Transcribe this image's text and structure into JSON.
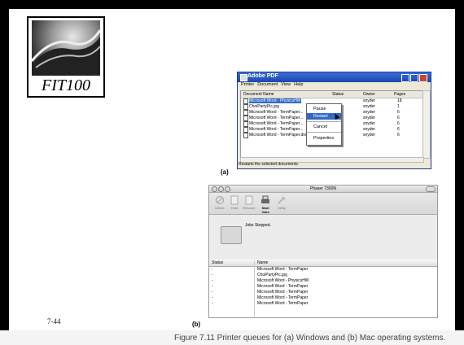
{
  "slide": {
    "logo_text": "FIT100",
    "page_number": "7-44",
    "caption": "Figure 7.11  Printer queues for (a) Windows and (b) Mac operating systems.",
    "label_a": "(a)",
    "label_b": "(b)"
  },
  "windows": {
    "title": "Adobe PDF",
    "menu": [
      "Printer",
      "Document",
      "View",
      "Help"
    ],
    "columns": [
      "Document Name",
      "Status",
      "Owner",
      "Pages"
    ],
    "rows": [
      {
        "name": "Microsoft Word - PhysicsHW",
        "status": "",
        "owner": "snyder",
        "pages": "18"
      },
      {
        "name": "ChoiPartyPic.jpg",
        "status": "",
        "owner": "snyder",
        "pages": "1"
      },
      {
        "name": "Microsoft Word - TermPaper...",
        "status": "",
        "owner": "snyder",
        "pages": "6"
      },
      {
        "name": "Microsoft Word - TermPaper...",
        "status": "",
        "owner": "snyder",
        "pages": "6"
      },
      {
        "name": "Microsoft Word - TermPaper...",
        "status": "",
        "owner": "snyder",
        "pages": "6"
      },
      {
        "name": "Microsoft Word - TermPaper...",
        "status": "",
        "owner": "snyder",
        "pages": "6"
      },
      {
        "name": "Microsoft Word - TermPaper.doc",
        "status": "",
        "owner": "snyder",
        "pages": "6"
      }
    ],
    "context_menu": [
      "Pause",
      "Restart",
      "Cancel",
      "Properties"
    ],
    "status_bar": "Restarts the selected documents."
  },
  "mac": {
    "title": "Phaser 7300N",
    "toolbar": [
      "Delete",
      "Hold",
      "Resume",
      "Start Jobs",
      "Utility"
    ],
    "status": "Jobs Stopped.",
    "columns": [
      "Status",
      "Name"
    ],
    "rows": [
      {
        "status": "-",
        "name": "Microsoft Word - TermPaper"
      },
      {
        "status": "-",
        "name": "ChoiPartyPic.jpg"
      },
      {
        "status": "-",
        "name": "Microsoft Word - PhysicsHW"
      },
      {
        "status": "-",
        "name": "Microsoft Word - TermPaper"
      },
      {
        "status": "-",
        "name": "Microsoft Word - TermPaper"
      },
      {
        "status": "-",
        "name": "Microsoft Word - TermPaper"
      },
      {
        "status": "-",
        "name": "Microsoft Word - TermPaper"
      }
    ]
  }
}
